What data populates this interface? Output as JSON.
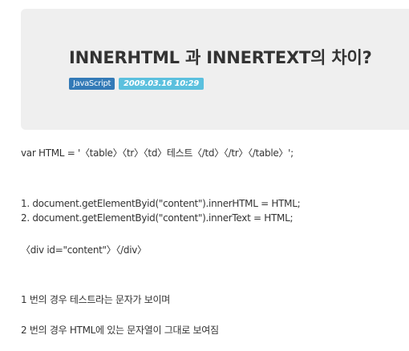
{
  "post": {
    "title": "INNERHTML 과 INNERTEXT의 차이?",
    "category": "JavaScript",
    "date": "2009.03.16 10:29"
  },
  "content": {
    "lines": [
      "var HTML = '〈table〉〈tr〉〈td〉테스트〈/td〉〈/tr〉〈/table〉';",
      "1. document.getElementByid(\"content\").innerHTML = HTML;",
      "2. document.getElementByid(\"content\").innerText = HTML;",
      "〈div id=\"content\"〉〈/div〉",
      "1 번의 경우 테스트라는 문자가 보이며",
      "2 번의 경우 HTML에 있는 문자열이 그대로 보여짐"
    ]
  }
}
